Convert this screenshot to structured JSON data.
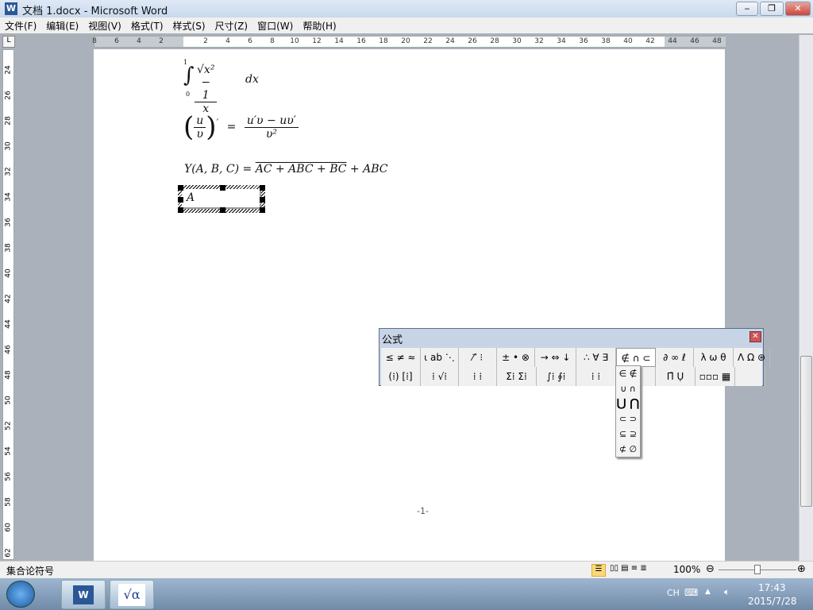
{
  "window": {
    "title": "文档 1.docx - Microsoft Word",
    "app_icon": "W",
    "minimize": "‒",
    "restore": "❐",
    "close": "✕"
  },
  "menu": [
    "文件(F)",
    "编辑(E)",
    "视图(V)",
    "格式(T)",
    "样式(S)",
    "尺寸(Z)",
    "窗口(W)",
    "帮助(H)"
  ],
  "ruler": {
    "left": [
      "8",
      "6",
      "4",
      "2"
    ],
    "right": [
      "2",
      "4",
      "6",
      "8",
      "10",
      "12",
      "14",
      "16",
      "18",
      "20",
      "22",
      "24",
      "26",
      "28",
      "30",
      "32",
      "34",
      "36",
      "38",
      "40",
      "42",
      "44",
      "46",
      "48"
    ],
    "vertical": [
      "24",
      "26",
      "28",
      "30",
      "32",
      "34",
      "36",
      "38",
      "40",
      "42",
      "44",
      "46",
      "48",
      "50",
      "52",
      "54",
      "56",
      "58",
      "60",
      "62"
    ]
  },
  "document": {
    "eq1": {
      "upper": "1",
      "lower": "0",
      "num": "√x² − 1",
      "den": "x",
      "tail": "dx"
    },
    "eq2": {
      "num": "u",
      "den": "υ",
      "prime": "′",
      "eq": "=",
      "rnum": "u′υ − uυ′",
      "rden": "υ²"
    },
    "eq3": {
      "lhs": "Y(A, B, C) =",
      "t1": "AC + ",
      "t2a": "A",
      "t2b": "BC + ",
      "t3a": "B",
      "t3b": "C",
      "t4": " + ABC"
    },
    "edit_box": "A",
    "page_number": "-1-"
  },
  "palette": {
    "title": "公式",
    "close": "✕",
    "row1": [
      "≤ ≠ ≈",
      "⍳ ab ⋱",
      "⁄ ⃗ ⁝",
      "± • ⊗",
      "→ ⇔ ↓",
      "∴ ∀ ∃",
      "∉ ∩ ⊂",
      "∂ ∞ ℓ",
      "λ ω θ",
      "Λ Ω ⊛"
    ],
    "row2": [
      "(⁞) [⁞]",
      "⁞ √⁞",
      "⁞ ⁞",
      "Σ⁞ Σ⁞",
      "∫⁞ ∮⁞",
      "⁞ ⁞",
      "",
      "Π̄ Ụ",
      "▫▫▫ ▦",
      ""
    ],
    "dropdown": [
      "∈ ∉",
      "∪ ∩",
      "⋃ ⋂",
      "⊂ ⊃",
      "⊆ ⊇",
      "⊄ ∅"
    ]
  },
  "status": {
    "text": "集合论符号",
    "zoom": "100%"
  },
  "taskbar": {
    "tray_lang": "CH",
    "time": "17:43",
    "date": "2015/7/28"
  },
  "colors": {
    "accent": "#2b5797",
    "palette_title": "#c7d4e6"
  }
}
